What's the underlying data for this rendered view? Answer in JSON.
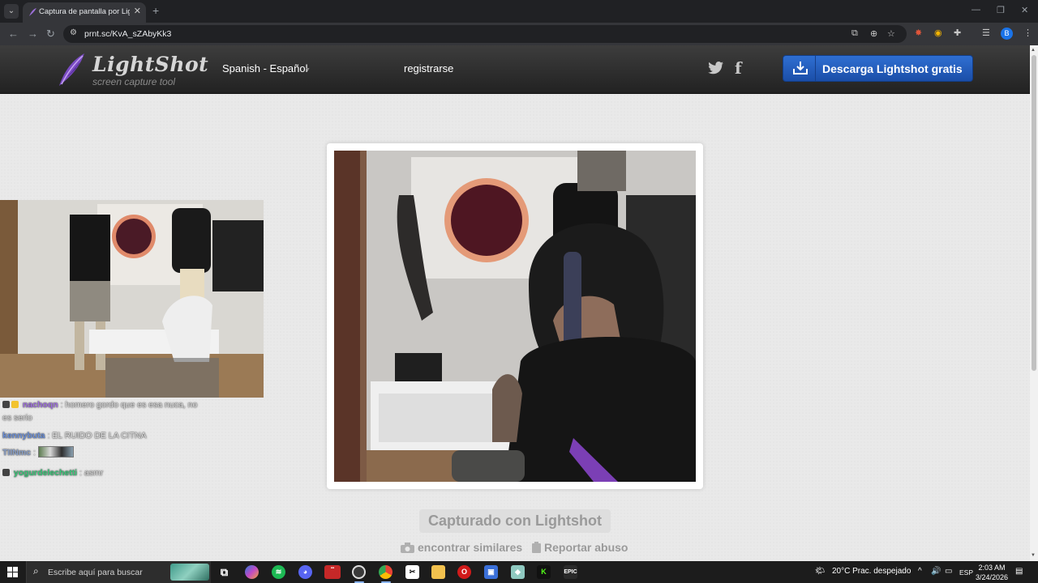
{
  "browser": {
    "tab_title": "Captura de pantalla por Lightsh",
    "new_tab": "+",
    "url": "prnt.sc/KvA_sZAbyKk3",
    "profile_initial": "B",
    "icons": [
      "tab-search-icon",
      "back-icon",
      "forward-icon",
      "reload-icon",
      "site-info-icon",
      "cast-icon",
      "zoom-icon",
      "star-icon",
      "extension-icon",
      "puzzle-icon",
      "reading-list-icon",
      "menu-icon",
      "minimize-icon",
      "maximize-icon",
      "close-icon"
    ]
  },
  "site": {
    "logo_title": "LightShot",
    "logo_subtitle": "screen capture tool",
    "language": "Spanish - Español",
    "register": "registrarse",
    "download_button": "Descarga Lightshot gratis",
    "caption": "Capturado con Lightshot",
    "find_similar": "encontrar similares",
    "report_abuse": "Reportar abuso",
    "accent_color": "#1f5bbd"
  },
  "chat": {
    "messages": [
      {
        "user": "nachoqn",
        "text": ": homero gordo que es esa nuca, no",
        "text2": "es serio",
        "user_color": "#a070e0"
      },
      {
        "user": "kennybuta",
        "text": ": EL RUIDO DE LA CITNA",
        "user_color": "#6a8fd8"
      },
      {
        "user": "TIINmc",
        "text": ":",
        "user_color": "#8aa0c8"
      },
      {
        "user": "yogurdelechetti",
        "text": ": asmr",
        "user_color": "#3cc77a"
      }
    ]
  },
  "taskbar": {
    "search_placeholder": "Escribe aquí para buscar",
    "weather": "20°C  Prac. despejado",
    "language": "ESP",
    "time": "2:03 AM",
    "date": "3/24/2026"
  }
}
